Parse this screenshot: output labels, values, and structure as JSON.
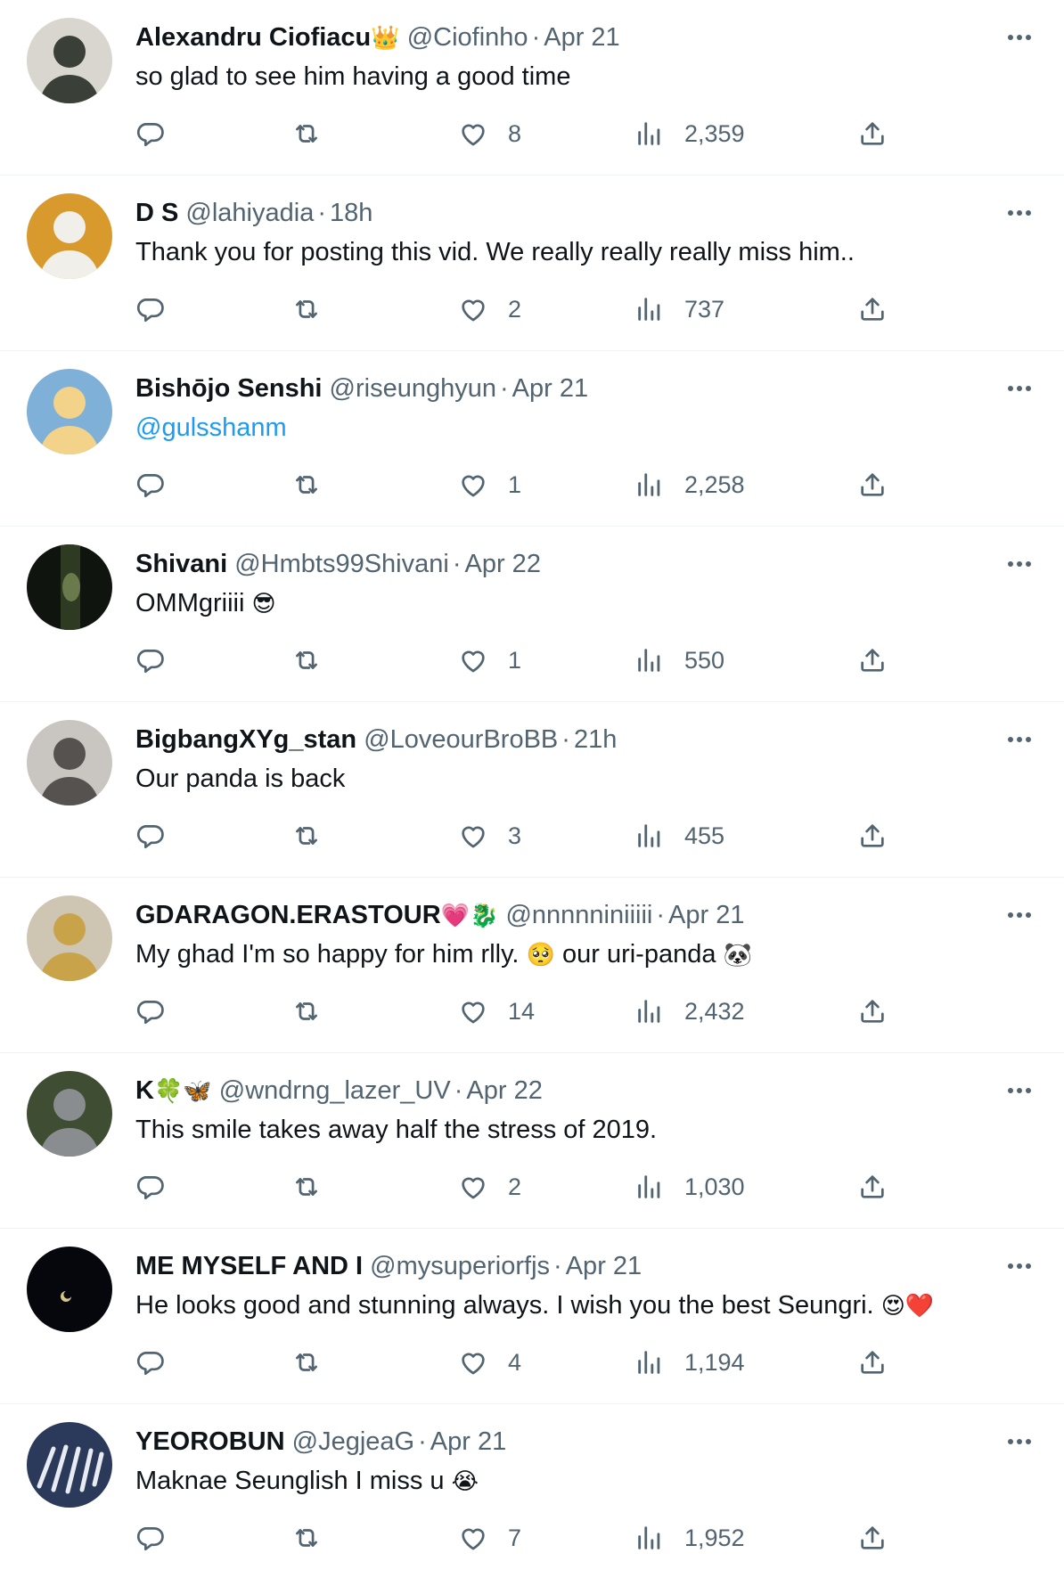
{
  "tweets": [
    {
      "name": "Alexandru Ciofiacu",
      "name_emoji": "👑",
      "handle": "@Ciofinho",
      "time": "Apr 21",
      "text": "so glad to see him having a good time",
      "likes": "8",
      "views": "2,359",
      "avatar": {
        "bg": "#d9d6cf",
        "fg": "#3a3f37",
        "icon": "avatar-man-sunglasses"
      }
    },
    {
      "name": "D S",
      "name_emoji": "",
      "handle": "@lahiyadia",
      "time": "18h",
      "text": "Thank you for posting this vid. We really really really miss him..",
      "likes": "2",
      "views": "737",
      "avatar": {
        "bg": "#d89a2c",
        "fg": "#f1efe9",
        "icon": "avatar-person-glasses"
      }
    },
    {
      "name": "Bishōjo Senshi",
      "name_emoji": "",
      "handle": "@riseunghyun",
      "time": "Apr 21",
      "text": "",
      "mention": "@gulsshanm",
      "likes": "1",
      "views": "2,258",
      "avatar": {
        "bg": "#7fb0d8",
        "fg": "#f3d28a",
        "icon": "avatar-anime-girl"
      }
    },
    {
      "name": "Shivani",
      "name_emoji": "",
      "handle": "@Hmbts99Shivani",
      "time": "Apr 22",
      "text": "OMMgriiii",
      "text_emoji": "😎",
      "likes": "1",
      "views": "550",
      "avatar": {
        "bg": "#0f140f",
        "fg": "#6b7a4c",
        "icon": "avatar-dark-forest"
      }
    },
    {
      "name": "BigbangXYg_stan",
      "name_emoji": "",
      "handle": "@LoveourBroBB",
      "time": "21h",
      "text": "Our panda is back",
      "likes": "3",
      "views": "455",
      "avatar": {
        "bg": "#c9c6c2",
        "fg": "#555250",
        "icon": "avatar-person-cap"
      }
    },
    {
      "name": "GDARAGON.ERASTOUR",
      "name_emoji": "💗🐉",
      "handle": "@nnnnniniiiii",
      "time": "Apr 21",
      "text": "My ghad I'm so happy for him rlly.",
      "text_emoji": "🥺",
      "text_after": "our uri-panda",
      "text_emoji2": "🐼",
      "likes": "14",
      "views": "2,432",
      "avatar": {
        "bg": "#cfc5b3",
        "fg": "#c9a34a",
        "icon": "avatar-woman-gold-mask"
      }
    },
    {
      "name": "K",
      "name_emoji": "🍀🦋",
      "handle": "@wndrng_lazer_UV",
      "time": "Apr 22",
      "text": "This smile takes away half the stress of 2019.",
      "likes": "2",
      "views": "1,030",
      "avatar": {
        "bg": "#3f4d32",
        "fg": "#8a8d8f",
        "icon": "avatar-woman-suit"
      }
    },
    {
      "name": "ME MYSELF AND I",
      "name_emoji": "",
      "handle": "@mysuperiorfjs",
      "time": "Apr 21",
      "text": "He looks good and stunning always. I wish you the best Seungri.",
      "text_emoji": "😍❤️",
      "likes": "4",
      "views": "1,194",
      "avatar": {
        "bg": "#05070d",
        "fg": "#d8c58a",
        "icon": "avatar-moon-night"
      }
    },
    {
      "name": "YEOROBUN",
      "name_emoji": "",
      "handle": "@JegjeaG",
      "time": "Apr 21",
      "text": "Maknae Seunglish I miss u",
      "text_emoji": "😭",
      "likes": "7",
      "views": "1,952",
      "avatar": {
        "bg": "#2b3a5a",
        "fg": "#e8ecf2",
        "icon": "avatar-lightsticks"
      }
    }
  ],
  "more_icon": "more-horizontal-icon",
  "icons": {
    "reply": "reply-icon",
    "retweet": "retweet-icon",
    "like": "heart-icon",
    "views": "views-chart-icon",
    "share": "share-icon"
  }
}
